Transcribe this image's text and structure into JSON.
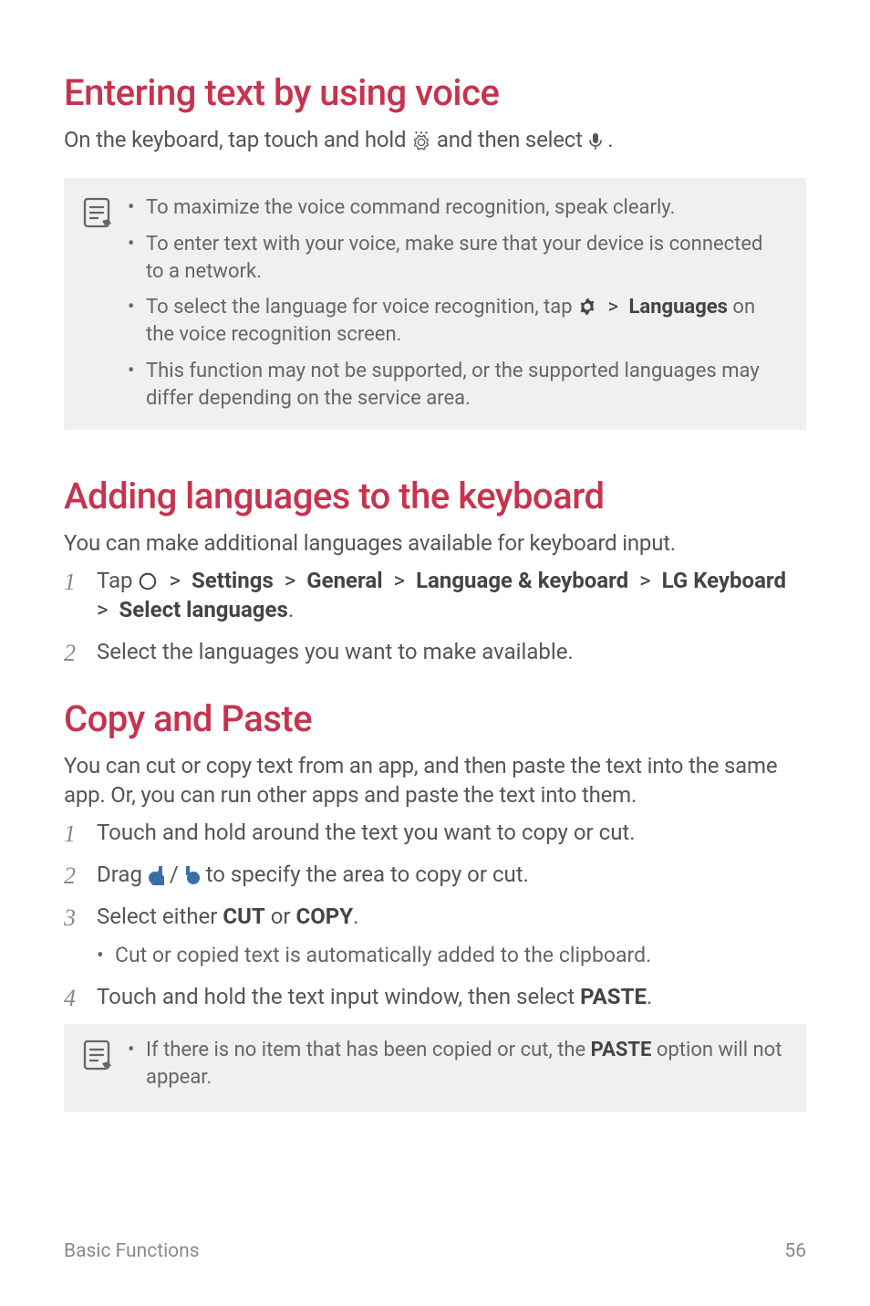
{
  "sections": {
    "voice": {
      "heading": "Entering text by using voice",
      "intro_a": "On the keyboard, tap touch and hold ",
      "intro_b": " and then select ",
      "intro_c": ".",
      "notes": {
        "n1": "To maximize the voice command recognition, speak clearly.",
        "n2": "To enter text with your voice, make sure that your device is connected to a network.",
        "n3_a": "To select the language for voice recognition, tap ",
        "n3_bold": "Languages",
        "n3_b": " on the voice recognition screen.",
        "n4": "This function may not be supported, or the supported languages may differ depending on the service area."
      }
    },
    "addlang": {
      "heading": "Adding languages to the keyboard",
      "intro": "You can make additional languages available for keyboard input.",
      "steps": {
        "s1_a": "Tap ",
        "s1_settings": "Settings",
        "s1_general": "General",
        "s1_langkb": "Language & keyboard",
        "s1_lgkb": "LG Keyboard",
        "s1_sel": "Select languages",
        "s1_dot": ".",
        "s2": "Select the languages you want to make available."
      }
    },
    "copypaste": {
      "heading": "Copy and Paste",
      "intro": "You can cut or copy text from an app, and then paste the text into the same app. Or, you can run other apps and paste the text into them.",
      "steps": {
        "s1": "Touch and hold around the text you want to copy or cut.",
        "s2_a": "Drag ",
        "s2_b": " / ",
        "s2_c": " to specify the area to copy or cut.",
        "s3_a": "Select either ",
        "s3_cut": "CUT",
        "s3_or": " or ",
        "s3_copy": "COPY",
        "s3_dot": ".",
        "s3_sub": "Cut or copied text is automatically added to the clipboard.",
        "s4_a": "Touch and hold the text input window, then select ",
        "s4_paste": "PASTE",
        "s4_dot": "."
      },
      "note": {
        "a": "If there is no item that has been copied or cut, the ",
        "paste": "PASTE",
        "b": " option will not appear."
      }
    }
  },
  "numbers": {
    "n1": "1",
    "n2": "2",
    "n3": "3",
    "n4": "4"
  },
  "gt": ">",
  "footer": {
    "left": "Basic Functions",
    "right": "56"
  }
}
